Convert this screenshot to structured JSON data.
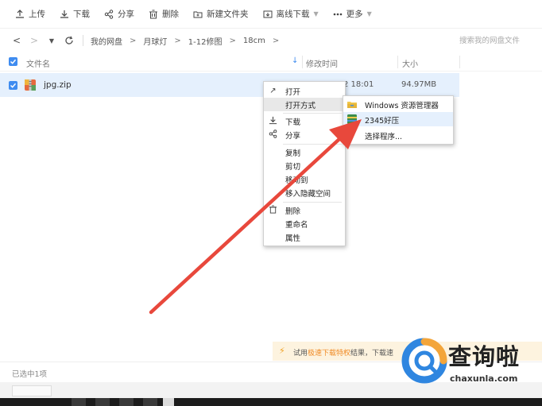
{
  "toolbar": {
    "buttons": [
      {
        "label": "上传",
        "icon": "upload-icon"
      },
      {
        "label": "下载",
        "icon": "download-icon"
      },
      {
        "label": "分享",
        "icon": "share-icon"
      },
      {
        "label": "删除",
        "icon": "trash-icon"
      },
      {
        "label": "新建文件夹",
        "icon": "new-folder-icon"
      },
      {
        "label": "离线下载",
        "icon": "offline-download-icon"
      },
      {
        "label": "更多",
        "icon": "more-icon"
      }
    ]
  },
  "address_bar": {
    "breadcrumbs": [
      "我的网盘",
      "月球灯",
      "1-12修图",
      "18cm"
    ],
    "search_placeholder": "搜索我的网盘文件"
  },
  "file_list": {
    "columns": {
      "name": "文件名",
      "modified": "修改时间",
      "size": "大小"
    },
    "rows": [
      {
        "name": "jpg.zip",
        "modified": "2 18:01",
        "size": "94.97MB",
        "icon": "zip-archive-icon",
        "selected": true
      }
    ]
  },
  "context_menu": {
    "items": [
      {
        "label": "打开",
        "icon": "open-arrow-icon"
      },
      {
        "label": "打开方式",
        "icon": ""
      },
      {
        "label": "下载",
        "icon": "download-icon"
      },
      {
        "label": "分享",
        "icon": "share-icon"
      },
      {
        "label": "复制",
        "icon": ""
      },
      {
        "label": "剪切",
        "icon": ""
      },
      {
        "label": "移动到",
        "icon": ""
      },
      {
        "label": "移入隐藏空间",
        "icon": ""
      },
      {
        "label": "删除",
        "icon": "trash-icon"
      },
      {
        "label": "重命名",
        "icon": ""
      },
      {
        "label": "属性",
        "icon": ""
      }
    ]
  },
  "submenu": {
    "items": [
      {
        "label": "Windows 资源管理器",
        "icon": "windows-explorer-icon"
      },
      {
        "label": "2345好压",
        "icon": "haozip-icon"
      },
      {
        "label": "选择程序...",
        "icon": ""
      }
    ]
  },
  "promo": {
    "prefix": "试用",
    "highlight": "极速下载特权",
    "suffix": "结果，下载速"
  },
  "status": {
    "text": "已选中1项"
  },
  "watermark": {
    "text": "查询啦",
    "url": "chaxunla.com"
  },
  "colors": {
    "accent": "#3f8cf0",
    "selected_row": "#e5f0fd",
    "arrow": "#e8483c",
    "promo_bg": "#fdf3df",
    "promo_highlight": "#f08a24"
  }
}
